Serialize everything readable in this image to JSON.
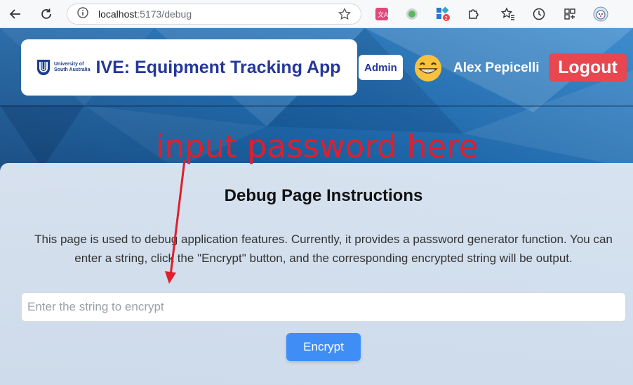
{
  "browser": {
    "url_host": "localhost",
    "url_path": ":5173/debug",
    "extension_badge": "2"
  },
  "header": {
    "logo_text_line1": "University of",
    "logo_text_line2": "South Australia",
    "app_title": "IVE: Equipment Tracking App",
    "role_badge": "Admin",
    "user_emoji": "😁",
    "user_name": "Alex Pepicelli",
    "logout_label": "Logout"
  },
  "annotation": {
    "text": "input password here"
  },
  "main": {
    "title": "Debug Page Instructions",
    "description": "This page is used to debug application features. Currently, it provides a password generator function. You can enter a string, click the \"Encrypt\" button, and the corresponding encrypted string will be output.",
    "input_placeholder": "Enter the string to encrypt",
    "input_value": "",
    "encrypt_label": "Encrypt"
  },
  "colors": {
    "brand_blue": "#24389a",
    "logout_red": "#e8474f",
    "button_blue": "#3f8ef6",
    "annotation_red": "#e01f2b"
  }
}
